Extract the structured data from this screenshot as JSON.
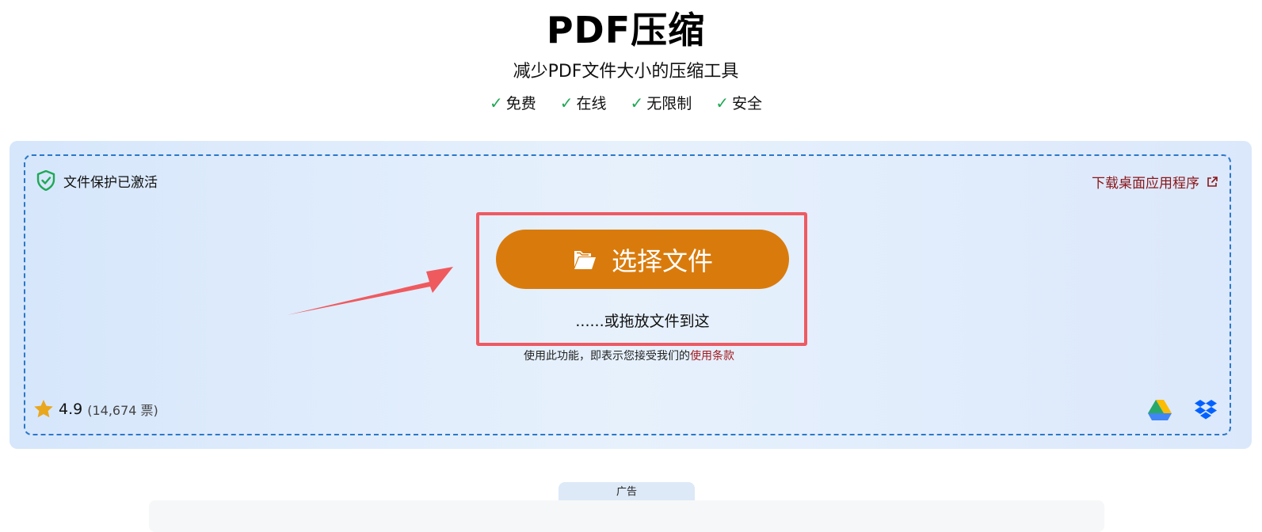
{
  "header": {
    "title": "PDF压缩",
    "subtitle": "减少PDF文件大小的压缩工具",
    "features": [
      "免费",
      "在线",
      "无限制",
      "安全"
    ]
  },
  "upload": {
    "protection_label": "文件保护已激活",
    "download_label": "下载桌面应用程序",
    "choose_button_label": "选择文件",
    "drop_text": "......或拖放文件到这",
    "terms_prefix": "使用此功能，即表示您接受我们的",
    "terms_link": "使用条款"
  },
  "rating": {
    "score": "4.9",
    "votes": "(14,674 票)"
  },
  "cloud_services": [
    "google-drive-icon",
    "dropbox-icon"
  ],
  "ad": {
    "label": "广告"
  },
  "colors": {
    "accent_button": "#d97b0c",
    "highlight": "#ee5a62",
    "check": "#1fa855",
    "link": "#8b1518",
    "dashed_border": "#2b78c9"
  }
}
